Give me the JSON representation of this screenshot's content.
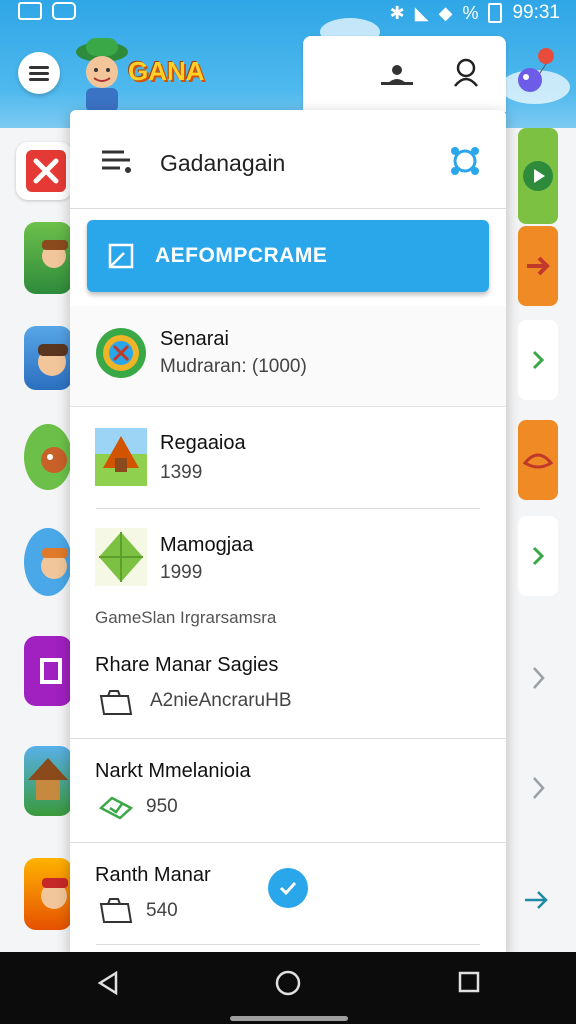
{
  "status_bar": {
    "time": "99:31",
    "battery_text": "%"
  },
  "header": {
    "logo_text": "GANA"
  },
  "drawer": {
    "title": "Gadanagain",
    "primary_button_label": "AEFOMPCRAME",
    "account": {
      "title": "Senarai",
      "subtitle": "Mudraran: (1000)"
    },
    "items": [
      {
        "title": "Regaaioa",
        "value": "1399"
      },
      {
        "title": "Mamogjaa",
        "value": "1999"
      }
    ],
    "section_label": "GameSlan Irgrarsamsra",
    "detail_items": [
      {
        "title": "Rhare Manar Sagies",
        "value": "A2nieAncraruHB"
      },
      {
        "title": "Narkt Mmelanioia",
        "value": "950"
      },
      {
        "title": "Ranth Manar",
        "value": "540"
      }
    ]
  },
  "colors": {
    "accent": "#2aa6ea",
    "header_bg": "#2fa6e6",
    "green": "#3aa846"
  }
}
